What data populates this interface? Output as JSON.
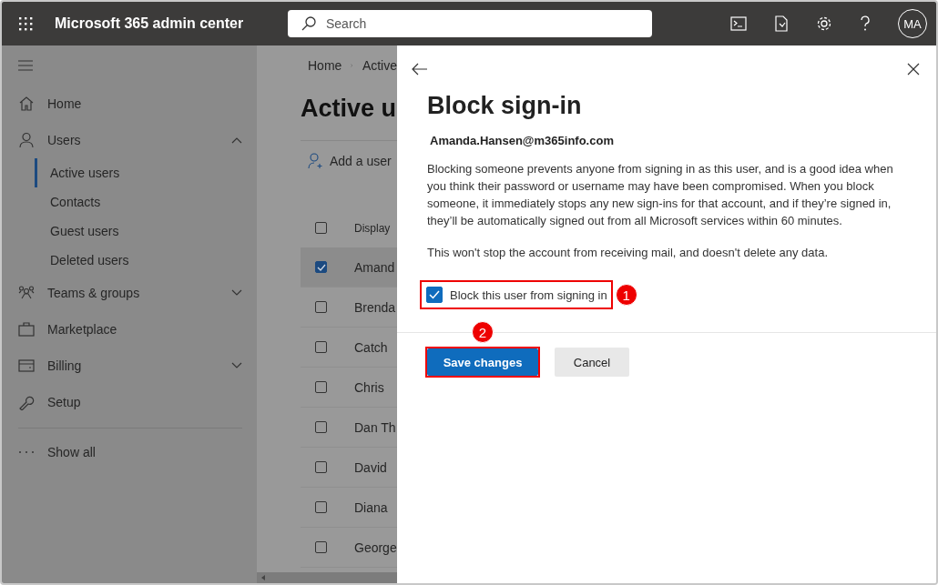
{
  "header": {
    "app_title": "Microsoft 365 admin center",
    "search": {
      "placeholder": "Search"
    },
    "avatar": "MA"
  },
  "sidebar": {
    "items": [
      {
        "label": "Home"
      },
      {
        "label": "Users",
        "expanded": true,
        "children": [
          {
            "label": "Active users",
            "selected": true
          },
          {
            "label": "Contacts",
            "selected": false
          },
          {
            "label": "Guest users",
            "selected": false
          },
          {
            "label": "Deleted users",
            "selected": false
          }
        ]
      },
      {
        "label": "Teams & groups",
        "expanded": false
      },
      {
        "label": "Marketplace"
      },
      {
        "label": "Billing",
        "expanded": false
      },
      {
        "label": "Setup"
      }
    ],
    "show_all": "Show all"
  },
  "main": {
    "breadcrumb": [
      "Home",
      "Active"
    ],
    "title": "Active u",
    "toolbar": {
      "add_user": "Add a user"
    },
    "table": {
      "column_1": "Display",
      "select_all_checked": false,
      "rows": [
        {
          "name": "Amand",
          "checked": true,
          "selected": true
        },
        {
          "name": "Brenda",
          "checked": false,
          "selected": false
        },
        {
          "name": "Catch",
          "checked": false,
          "selected": false
        },
        {
          "name": "Chris",
          "checked": false,
          "selected": false
        },
        {
          "name": "Dan Th",
          "checked": false,
          "selected": false
        },
        {
          "name": "David",
          "checked": false,
          "selected": false
        },
        {
          "name": "Diana",
          "checked": false,
          "selected": false
        },
        {
          "name": "George",
          "checked": false,
          "selected": false
        }
      ]
    }
  },
  "panel": {
    "title": "Block sign-in",
    "email": "Amanda.Hansen@m365info.com",
    "paragraphs": [
      "Blocking someone prevents anyone from signing in as this user, and is a good idea when you think their password or username may have been compromised. When you block someone, it immediately stops any new sign-ins for that account, and if they’re signed in, they’ll be automatically signed out from all Microsoft services within 60 minutes.",
      "This won't stop the account from receiving mail, and doesn't delete any data."
    ],
    "checkbox": {
      "label": "Block this user from signing in",
      "checked": true,
      "callout": "1"
    },
    "buttons": [
      {
        "label": "Save changes",
        "kind": "primary",
        "callout": "2"
      },
      {
        "label": "Cancel",
        "kind": "secondary"
      }
    ]
  }
}
